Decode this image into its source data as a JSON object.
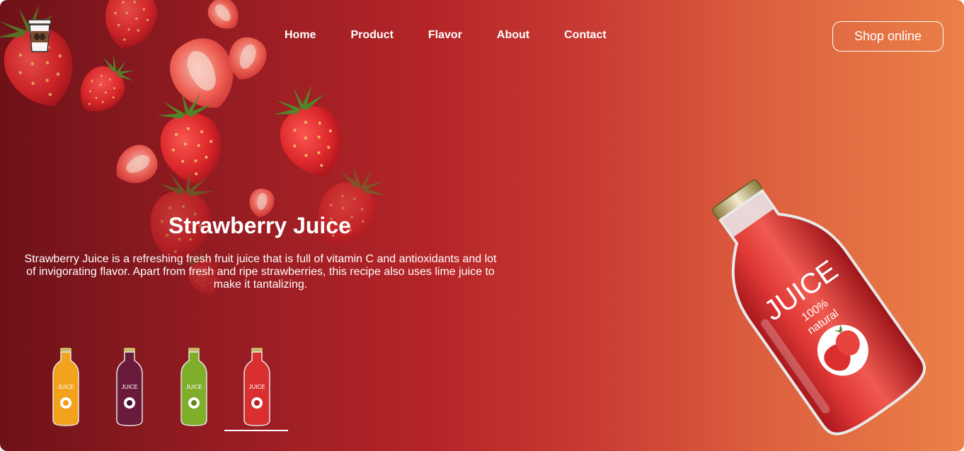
{
  "header": {
    "logo_icon": "juice-cup-icon",
    "nav": [
      {
        "label": "Home"
      },
      {
        "label": "Product"
      },
      {
        "label": "Flavor"
      },
      {
        "label": "About"
      },
      {
        "label": "Contact"
      }
    ],
    "shop_label": "Shop online"
  },
  "hero": {
    "title": "Strawberry Juice",
    "description": "Strawberry Juice is a refreshing fresh fruit juice that is full of vitamin C and antioxidants and lot of invigorating flavor. Apart from fresh and ripe strawberries, this recipe also uses lime juice to make it tantalizing.",
    "bottle_label": "JUICE",
    "bottle_sub1": "100%",
    "bottle_sub2": "natural"
  },
  "thumbnails": [
    {
      "flavor": "orange",
      "color": "#f3a21d",
      "label": "JUICE"
    },
    {
      "flavor": "grape",
      "color": "#6a1a3a",
      "label": "JUICE"
    },
    {
      "flavor": "kiwi",
      "color": "#7fae2a",
      "label": "JUICE"
    },
    {
      "flavor": "strawberry",
      "color": "#d9302f",
      "label": "JUICE",
      "selected": true
    }
  ],
  "colors": {
    "gradient_start": "#6e1218",
    "gradient_end": "#ea8148",
    "accent": "#ffffff"
  }
}
